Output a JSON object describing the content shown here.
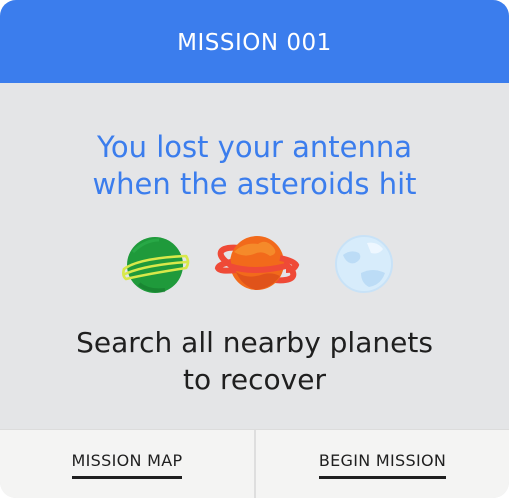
{
  "header": {
    "title": "MISSION 001"
  },
  "intro": {
    "line1": "You lost your antenna",
    "line2": "when the asteroids hit"
  },
  "planets": [
    {
      "name": "green-planet-icon",
      "color": "#1f9a3b",
      "ring": "#d8e84a"
    },
    {
      "name": "orange-planet-icon",
      "color": "#f26a1b",
      "ring": "#ef4a37"
    },
    {
      "name": "ice-planet-icon",
      "color": "#d7ecfb",
      "ring": ""
    }
  ],
  "instruction": {
    "line1": "Search all nearby planets",
    "line2": "to recover"
  },
  "footer": {
    "map_label": "MISSION MAP",
    "begin_label": "BEGIN MISSION"
  },
  "colors": {
    "accent": "#3b7ded",
    "card_bg": "#e4e5e7",
    "footer_bg": "#f4f4f3",
    "text": "#1f1f1f"
  }
}
